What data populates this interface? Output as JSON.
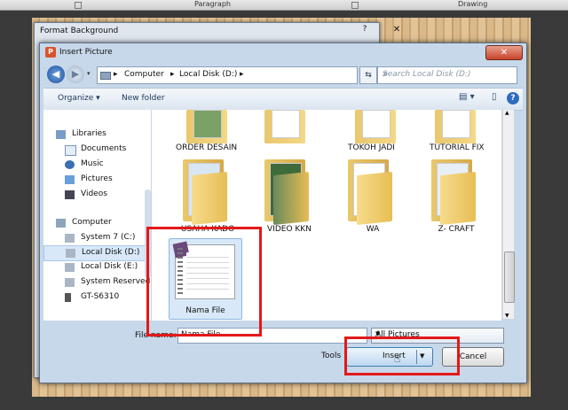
{
  "ribbon": {
    "paragraph": "Paragraph",
    "drawing": "Drawing"
  },
  "format_background": {
    "title": "Format Background",
    "help": "?",
    "close": "✕"
  },
  "dialog": {
    "title": "Insert Picture",
    "close": "✕",
    "address": {
      "computer": "Computer",
      "disk": "Local Disk (D:)",
      "sep": "▸"
    },
    "search_placeholder": "Search Local Disk (D:)",
    "toolbar": {
      "organize": "Organize ▾",
      "new_folder": "New folder"
    },
    "nav": {
      "libraries": "Libraries",
      "documents": "Documents",
      "music": "Music",
      "pictures": "Pictures",
      "videos": "Videos",
      "computer": "Computer",
      "system7": "System 7 (C:)",
      "local_d": "Local Disk (D:)",
      "local_e": "Local Disk (E:)",
      "system_reserved": "System Reserved",
      "gt": "GT-S6310"
    },
    "top_folders": [
      "ORDER DESAIN",
      "TOKOH JADI",
      "TUTORIAL FIX"
    ],
    "folders": [
      "USAHA KADO",
      "VIDEO KKN",
      "WA",
      "Z- CRAFT"
    ],
    "selected_file": "Nama File",
    "file_name_label": "File name:",
    "file_name_value": "Nama File",
    "file_type": "All Pictures",
    "tools": "Tools",
    "insert": "Insert",
    "cancel": "Cancel"
  }
}
